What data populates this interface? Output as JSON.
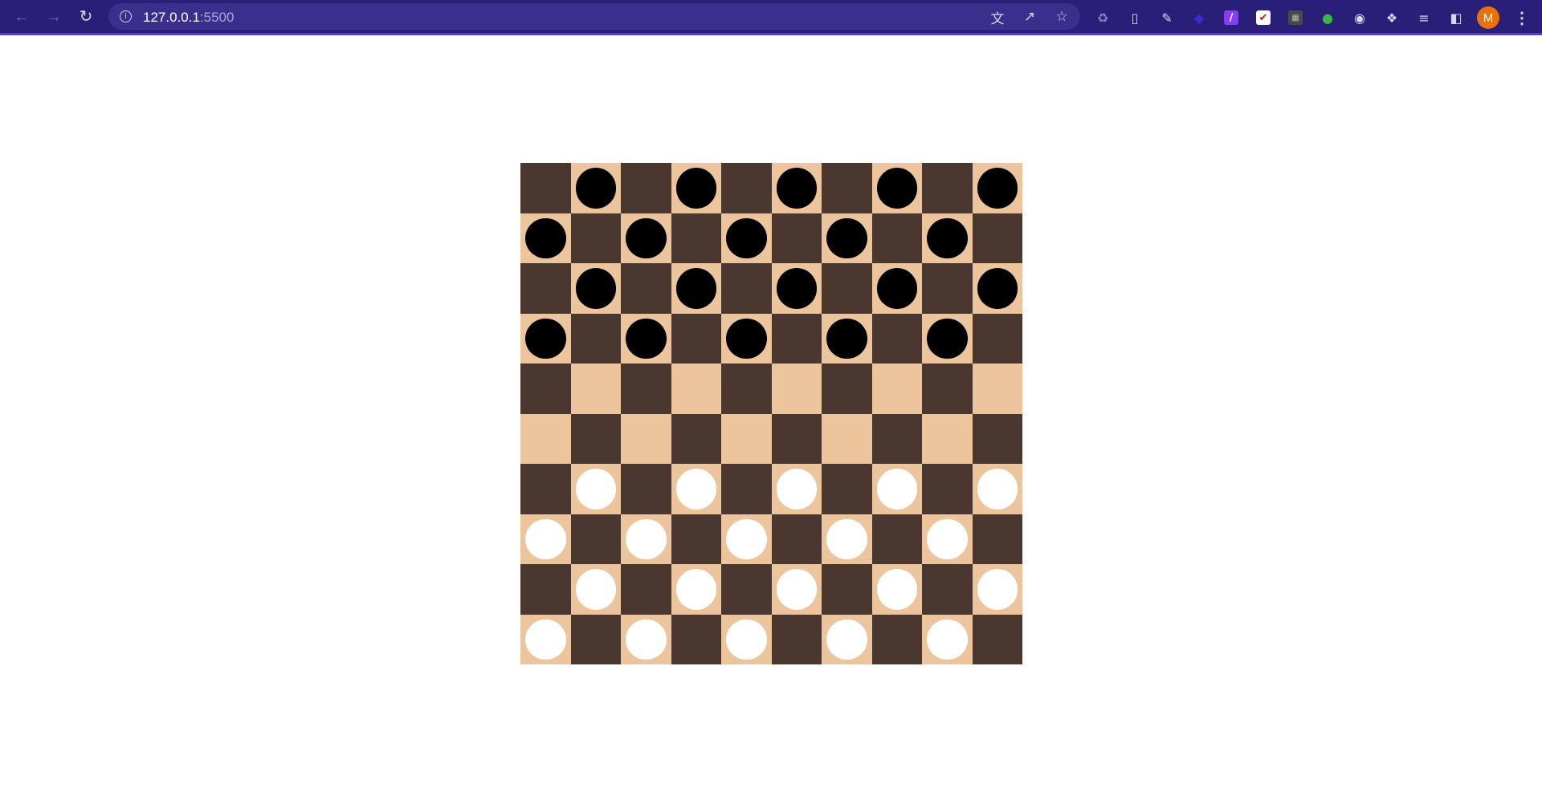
{
  "browser": {
    "url_host": "127.0.0.1",
    "url_port": ":5500",
    "avatar_letter": "M",
    "icons": {
      "back": "arrow-left-icon",
      "forward": "arrow-right-icon",
      "reload": "reload-icon",
      "info": "site-info-icon",
      "translate": "translate-icon",
      "share": "share-icon",
      "bookmark": "star-icon",
      "extensions": "puzzle-icon",
      "reading_list": "reading-list-icon",
      "side_panel": "side-panel-icon",
      "menu": "kebab-menu-icon"
    },
    "colors": {
      "toolbar": "#2a1f78",
      "accent": "#5a36d6",
      "avatar": "#e8710a"
    }
  },
  "board": {
    "rows": 10,
    "cols": 10,
    "colors": {
      "light_square": "#ecc59c",
      "dark_square": "#4a372f",
      "black_piece": "#000000",
      "white_piece": "#ffffff"
    },
    "layout": [
      "-b-b-b-b-b",
      "b-b-b-b-b-",
      "-b-b-b-b-b",
      "b-b-b-b-b-",
      "----------",
      "----------",
      "-w-w-w-w-w",
      "w-w-w-w-w-",
      "-w-w-w-w-w",
      "w-w-w-w-w-"
    ]
  }
}
